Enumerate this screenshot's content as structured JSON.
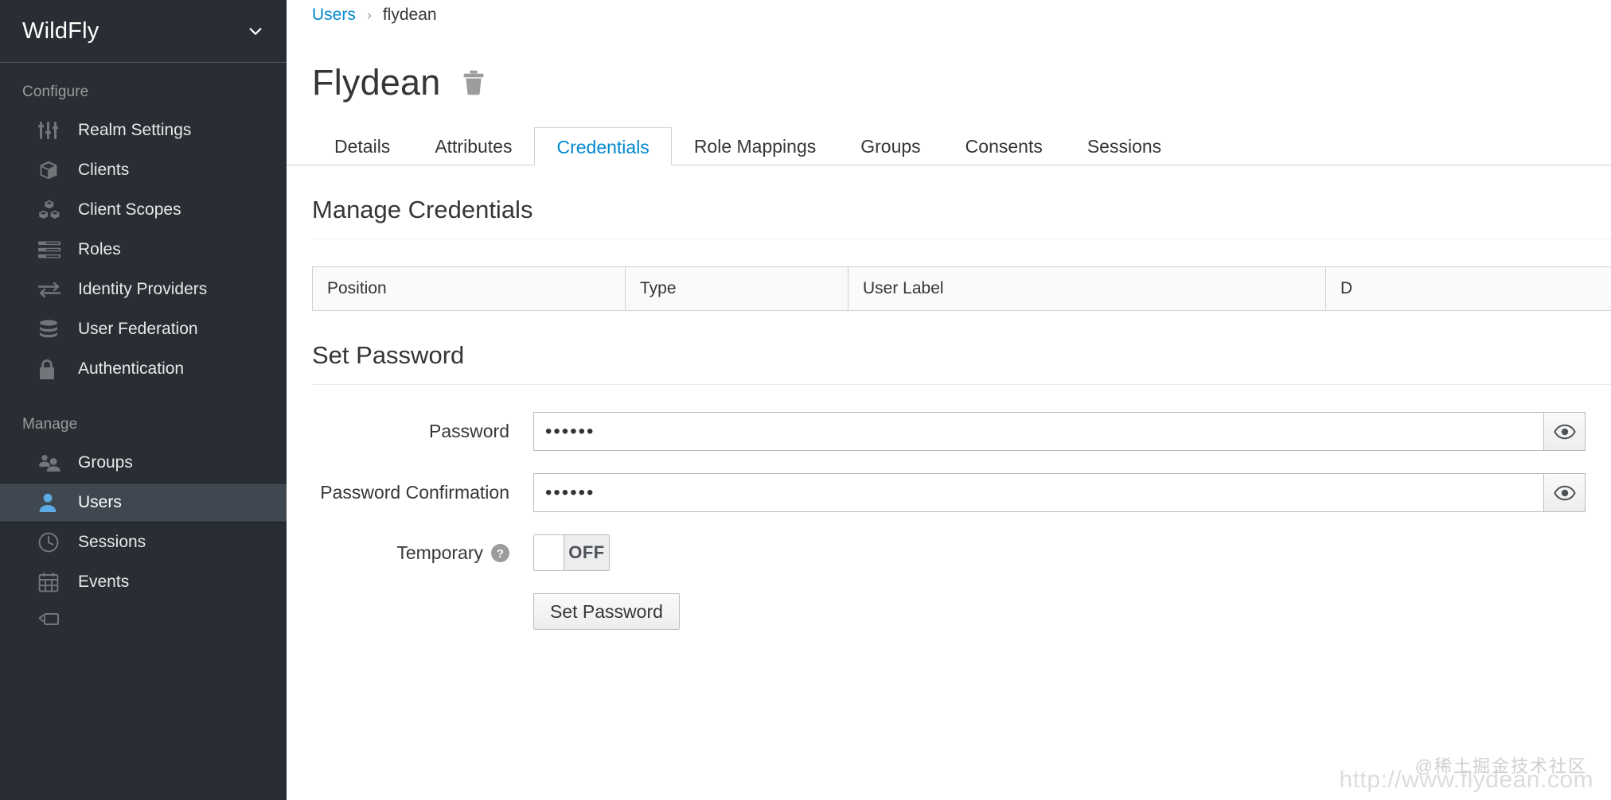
{
  "sidebar": {
    "realm": {
      "name": "WildFly",
      "chevron_icon": "chevron-down-icon"
    },
    "groups": [
      {
        "title": "Configure",
        "items": [
          {
            "label": "Realm Settings",
            "icon": "sliders-icon",
            "active": false
          },
          {
            "label": "Clients",
            "icon": "cube-icon",
            "active": false
          },
          {
            "label": "Client Scopes",
            "icon": "cubes-icon",
            "active": false
          },
          {
            "label": "Roles",
            "icon": "list-icon",
            "active": false
          },
          {
            "label": "Identity Providers",
            "icon": "exchange-arrows-icon",
            "active": false
          },
          {
            "label": "User Federation",
            "icon": "database-icon",
            "active": false
          },
          {
            "label": "Authentication",
            "icon": "lock-icon",
            "active": false
          }
        ]
      },
      {
        "title": "Manage",
        "items": [
          {
            "label": "Groups",
            "icon": "users-icon",
            "active": false
          },
          {
            "label": "Users",
            "icon": "user-icon",
            "active": true
          },
          {
            "label": "Sessions",
            "icon": "clock-icon",
            "active": false
          },
          {
            "label": "Events",
            "icon": "calendar-icon",
            "active": false
          }
        ]
      }
    ]
  },
  "breadcrumb": {
    "parent": "Users",
    "separator": "›",
    "current": "flydean"
  },
  "header": {
    "title": "Flydean",
    "delete_icon": "trash-icon"
  },
  "tabs": [
    {
      "label": "Details",
      "active": false
    },
    {
      "label": "Attributes",
      "active": false
    },
    {
      "label": "Credentials",
      "active": true
    },
    {
      "label": "Role Mappings",
      "active": false
    },
    {
      "label": "Groups",
      "active": false
    },
    {
      "label": "Consents",
      "active": false
    },
    {
      "label": "Sessions",
      "active": false
    }
  ],
  "manage_credentials": {
    "heading": "Manage Credentials",
    "columns": [
      "Position",
      "Type",
      "User Label",
      "D"
    ],
    "rows": []
  },
  "set_password": {
    "heading": "Set Password",
    "password": {
      "label": "Password",
      "value": "••••••",
      "reveal_icon": "eye-icon"
    },
    "password_confirmation": {
      "label": "Password Confirmation",
      "value": "••••••",
      "reveal_icon": "eye-icon"
    },
    "temporary": {
      "label": "Temporary",
      "help_icon": "question-circle-icon",
      "state": "OFF"
    },
    "submit_label": "Set Password"
  },
  "watermark": {
    "community": "@稀土掘金技术社区",
    "url": "http://www.flydean.com"
  },
  "colors": {
    "sidebar_bg": "#292e34",
    "sidebar_active_bg": "#3f4750",
    "accent_blue": "#0088ce",
    "icon_active_blue": "#5babe4",
    "text_dark": "#363636"
  }
}
